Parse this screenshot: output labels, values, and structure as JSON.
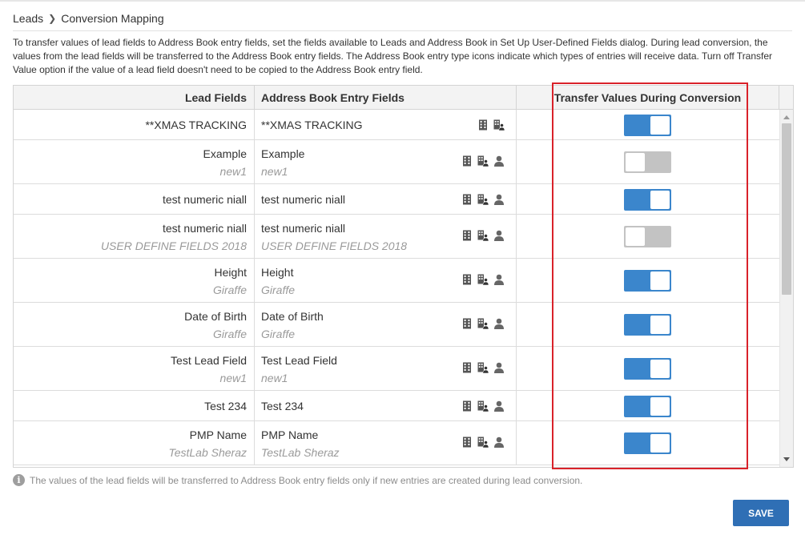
{
  "breadcrumb": {
    "parent": "Leads",
    "current": "Conversion Mapping"
  },
  "description": "To transfer values of lead fields to Address Book entry fields, set the fields available to Leads and Address Book in Set Up User-Defined Fields dialog. During lead conversion, the values from the lead fields will be transferred to the Address Book entry fields. The Address Book entry type icons indicate which types of entries will receive data. Turn off Transfer Value option if the value of a lead field doesn't need to be copied to the Address Book entry field.",
  "columns": {
    "lead": "Lead Fields",
    "address_book": "Address Book Entry Fields",
    "transfer": "Transfer Values During Conversion"
  },
  "rows": [
    {
      "lead_name": "**XMAS TRACKING",
      "lead_sub": "",
      "ab_name": "**XMAS TRACKING",
      "ab_sub": "",
      "icons": [
        "building-icon",
        "building-person-icon"
      ],
      "transfer": true
    },
    {
      "lead_name": "Example",
      "lead_sub": "new1",
      "ab_name": "Example",
      "ab_sub": "new1",
      "icons": [
        "building-icon",
        "building-person-icon",
        "person-icon"
      ],
      "transfer": false
    },
    {
      "lead_name": "test numeric niall",
      "lead_sub": "",
      "ab_name": "test numeric niall",
      "ab_sub": "",
      "icons": [
        "building-icon",
        "building-person-icon",
        "person-icon"
      ],
      "transfer": true
    },
    {
      "lead_name": "test numeric niall",
      "lead_sub": "USER DEFINE FIELDS 2018",
      "ab_name": "test numeric niall",
      "ab_sub": "USER DEFINE FIELDS 2018",
      "icons": [
        "building-icon",
        "building-person-icon",
        "person-icon"
      ],
      "transfer": false
    },
    {
      "lead_name": "Height",
      "lead_sub": "Giraffe",
      "ab_name": "Height",
      "ab_sub": "Giraffe",
      "icons": [
        "building-icon",
        "building-person-icon",
        "person-icon"
      ],
      "transfer": true
    },
    {
      "lead_name": "Date of Birth",
      "lead_sub": "Giraffe",
      "ab_name": "Date of Birth",
      "ab_sub": "Giraffe",
      "icons": [
        "building-icon",
        "building-person-icon",
        "person-icon"
      ],
      "transfer": true
    },
    {
      "lead_name": "Test Lead Field",
      "lead_sub": "new1",
      "ab_name": "Test Lead Field",
      "ab_sub": "new1",
      "icons": [
        "building-icon",
        "building-person-icon",
        "person-icon"
      ],
      "transfer": true
    },
    {
      "lead_name": "Test 234",
      "lead_sub": "",
      "ab_name": "Test 234",
      "ab_sub": "",
      "icons": [
        "building-icon",
        "building-person-icon",
        "person-icon"
      ],
      "transfer": true
    },
    {
      "lead_name": "PMP Name",
      "lead_sub": "TestLab Sheraz",
      "ab_name": "PMP Name",
      "ab_sub": "TestLab Sheraz",
      "icons": [
        "building-icon",
        "building-person-icon",
        "person-icon"
      ],
      "transfer": true
    }
  ],
  "footnote": "The values of the lead fields will be transferred to Address Book entry fields only if new entries are created during lead conversion.",
  "info_icon_glyph": "i",
  "save_label": "SAVE",
  "colors": {
    "toggle_on": "#3b86cc",
    "toggle_off": "#c3c3c3",
    "save_button": "#2f6fb5",
    "highlight": "#d9222a"
  }
}
